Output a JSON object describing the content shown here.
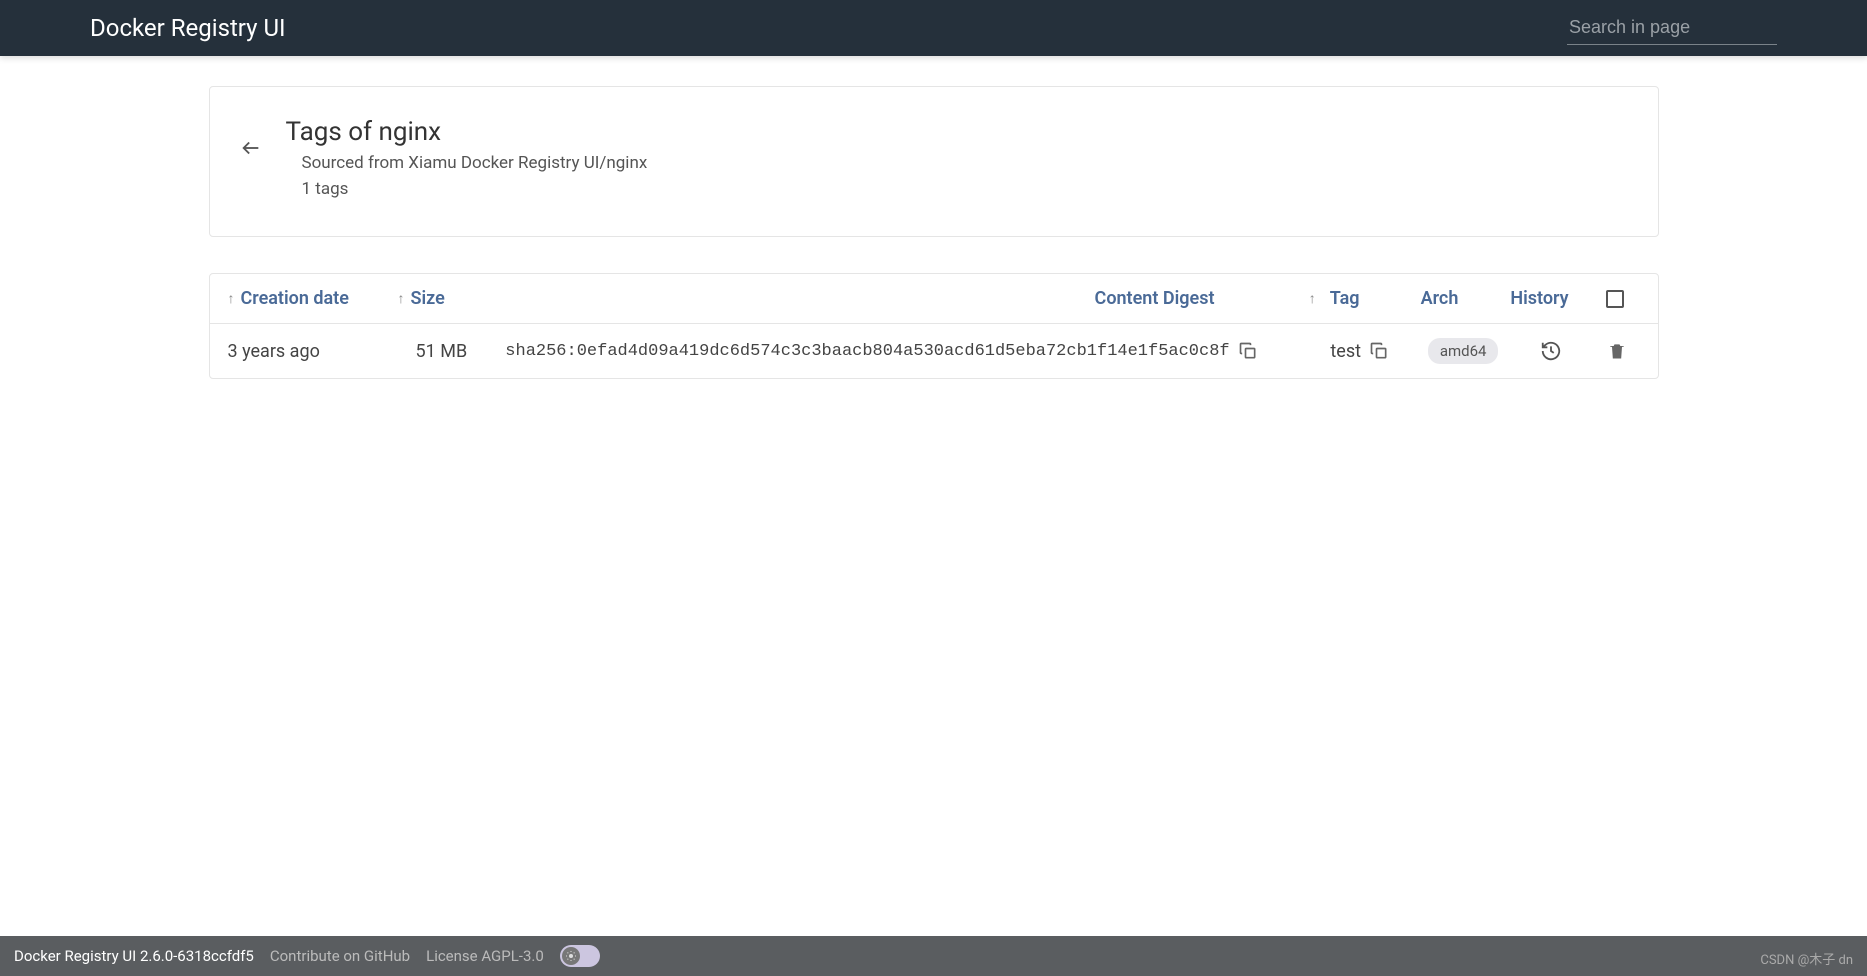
{
  "header": {
    "title": "Docker Registry UI",
    "search_placeholder": "Search in page"
  },
  "title_card": {
    "heading": "Tags of nginx",
    "source_line": "Sourced from Xiamu Docker Registry UI/nginx",
    "count_line": "1 tags"
  },
  "table": {
    "columns": {
      "creation": "Creation date",
      "size": "Size",
      "digest": "Content Digest",
      "tag": "Tag",
      "arch": "Arch",
      "history": "History"
    },
    "rows": [
      {
        "creation": "3 years ago",
        "size": "51 MB",
        "digest": "sha256:0efad4d09a419dc6d574c3c3baacb804a530acd61d5eba72cb1f14e1f5ac0c8f",
        "tag": "test",
        "arch": "amd64"
      }
    ]
  },
  "footer": {
    "version": "Docker Registry UI 2.6.0-6318ccfdf5",
    "contribute": "Contribute on GitHub",
    "license": "License AGPL-3.0"
  },
  "watermark": "CSDN @木子 dn"
}
